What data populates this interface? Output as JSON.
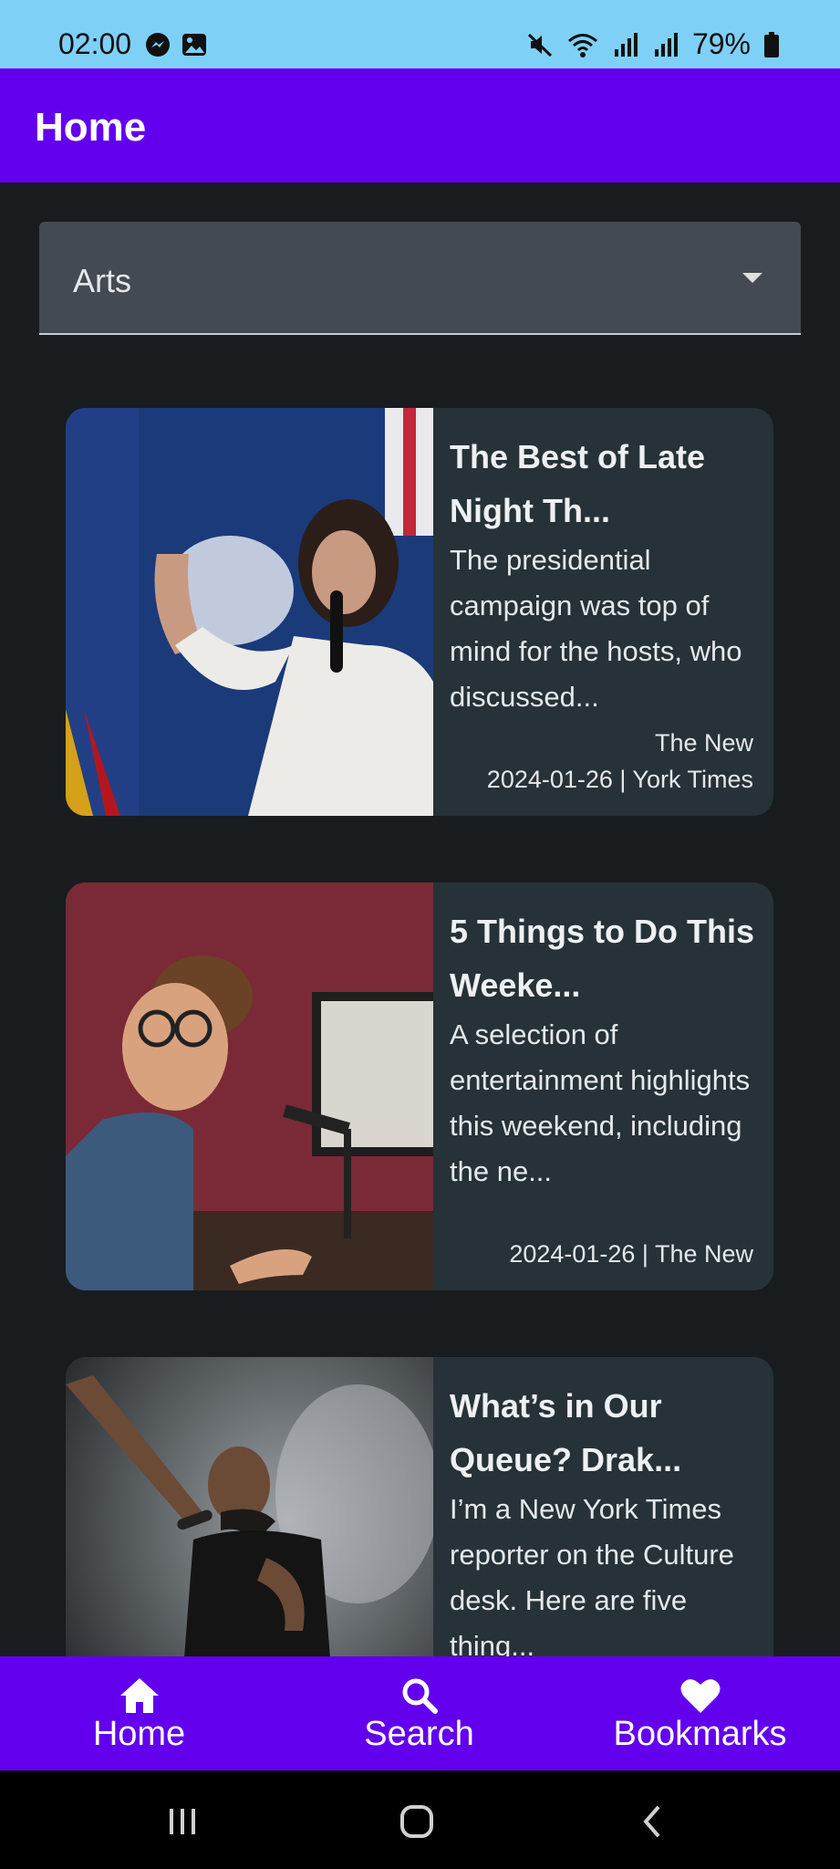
{
  "status_bar": {
    "time": "02:00",
    "left_icons": [
      "messenger-icon",
      "gallery-icon"
    ],
    "right_icons": [
      "mute-icon",
      "wifi-icon",
      "signal-icon",
      "signal-icon",
      "battery-icon"
    ],
    "battery": "79%"
  },
  "app_bar": {
    "title": "Home"
  },
  "category_dropdown": {
    "selected": "Arts"
  },
  "articles": [
    {
      "title": "The Best of Late Night Th...",
      "description": "The presidential campaign was top of mind for the hosts, who discussed...",
      "meta_line1": "The New",
      "meta_line2": "2024-01-26 | York Times"
    },
    {
      "title": "5 Things to Do This Weeke...",
      "description": "A selection of entertainment highlights this weekend, including the ne...",
      "meta_line1": "",
      "meta_line2": "2024-01-26 | The New"
    },
    {
      "title": "What’s in Our Queue? Drak...",
      "description": "I’m a New York Times reporter on the Culture desk. Here are five thing...",
      "meta_line1": "",
      "meta_line2": ""
    }
  ],
  "bottom_nav": {
    "items": [
      {
        "label": "Home",
        "icon": "home-icon"
      },
      {
        "label": "Search",
        "icon": "search-icon"
      },
      {
        "label": "Bookmarks",
        "icon": "heart-icon"
      }
    ]
  },
  "colors": {
    "status_bar": "#7fd0f7",
    "primary": "#6200ee",
    "background": "#181c1f",
    "card": "#263238",
    "dropdown": "#434a52"
  }
}
